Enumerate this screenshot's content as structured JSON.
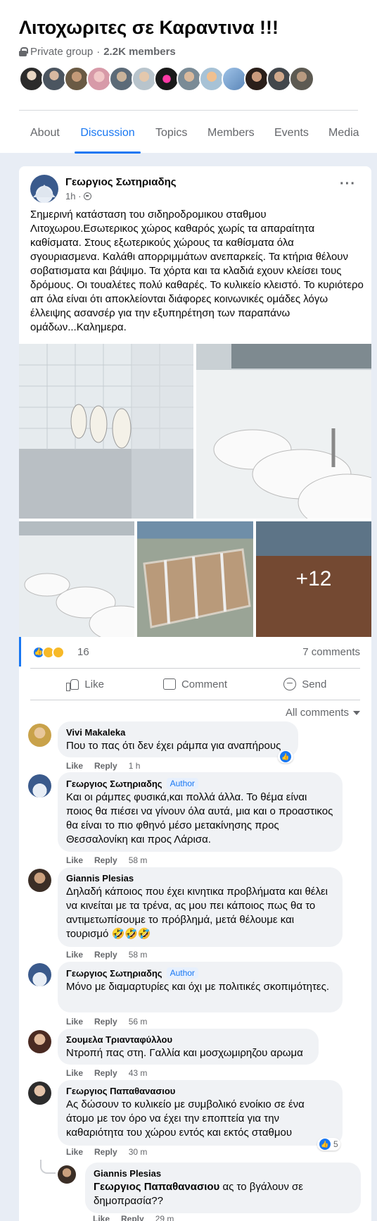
{
  "group": {
    "title": "Λιτοχωριτες σε Καραντινα !!!",
    "privacy": "Private group",
    "separator": "·",
    "members": "2.2K members"
  },
  "tabs": [
    {
      "label": "About",
      "active": false
    },
    {
      "label": "Discussion",
      "active": true
    },
    {
      "label": "Topics",
      "active": false
    },
    {
      "label": "Members",
      "active": false
    },
    {
      "label": "Events",
      "active": false
    },
    {
      "label": "Media",
      "active": false
    }
  ],
  "post": {
    "author": "Γεωργιος Σωτηριαδης",
    "time": "1h ·",
    "text": "Σημερινή κατάσταση του σιδηροδρομικου σταθμου Λιτοχωρου.Εσωτερικος χώρος καθαρός χωρίς τα απαραίτητα καθίσματα. Στους εξωτερικούς χώρους τα καθίσματα όλα σγουριασμενα. Καλάθι απορριμμάτων ανεπαρκείς. Τα κτήρια θέλουν σοβατισματα και βάψιμο. Τα χόρτα και τα κλαδιά εχουν κλείσει τους δρόμους. Οι τουαλέτες πολύ καθαρές. Το κυλικείο κλειστό. Το κυριότερο απ όλα είναι ότι αποκλείονται διάφορες κοινωνικές ομάδες λόγω έλλειψης ασανσέρ για την εξυπηρέτηση των παραπάνω ομάδων...Καλημερα.",
    "more_photos": "+12",
    "reaction_count": "16",
    "comments_count": "7 comments",
    "actions": {
      "like": "Like",
      "comment": "Comment",
      "send": "Send"
    },
    "all_comments": "All comments"
  },
  "comments": [
    {
      "name": "Vivi Makaleka",
      "badge": "",
      "text": "Που το πας ότι δεν έχει ράμπα για αναπήρους",
      "like": "Like",
      "reply": "Reply",
      "time": "1 h"
    },
    {
      "name": "Γεωργιος Σωτηριαδης",
      "badge": "Author",
      "text": "Και οι ράμπες φυσικά,και πολλά άλλα. Το θέμα είναι ποιος θα πιέσει να γίνουν όλα αυτά, μια και ο προαστικος θα είναι το πιο φθηνό μέσο μετακίνησης προς Θεσσαλονίκη και προς Λάρισα.",
      "like": "Like",
      "reply": "Reply",
      "time": "58 m"
    },
    {
      "name": "Giannis Plesias",
      "badge": "",
      "text": "Δηλαδή κάποιος που έχει κινητικα προβλήματα και θέλει να κινείται με τα τρένα, ας μου πει κάποιος πως θα το αντιμετωπίσουμε το πρόβλημά, μετά θέλουμε και τουρισμό 🤣🤣🤣",
      "like": "Like",
      "reply": "Reply",
      "time": "58 m"
    },
    {
      "name": "Γεωργιος Σωτηριαδης",
      "badge": "Author",
      "text": "Μόνο με διαμαρτυρίες και όχι με πολιτικές σκοπιμότητες.",
      "like": "Like",
      "reply": "Reply",
      "time": "56 m"
    },
    {
      "name": "Σουμελα Τριανταφύλλου",
      "badge": "",
      "text": "Ντροπή πας στη. Γαλλία και μοσχωμιρηζου αρωμα",
      "like": "Like",
      "reply": "Reply",
      "time": "43 m"
    },
    {
      "name": "Γεωργιος Παπαθανασιου",
      "badge": "",
      "text": "Ας δώσουν το κυλικείο με συμβολικό ενοίκιο σε ένα άτομο με τον όρο να έχει την εποπτεία για την καθαριότητα του χώρου εντός και εκτός σταθμου",
      "like": "Like",
      "reply": "Reply",
      "time": "30 m",
      "reactions": "5"
    },
    {
      "name": "Giannis Plesias",
      "badge": "",
      "mention": "Γεωργιος Παπαθανασιου",
      "text": " ας το βγάλουν σε δημοπρασία??",
      "like": "Like",
      "reply": "Reply",
      "time": "29 m"
    }
  ],
  "colors": {
    "accent": "#1877f2",
    "background": "#e8edf5",
    "bubble": "#f0f2f5"
  }
}
